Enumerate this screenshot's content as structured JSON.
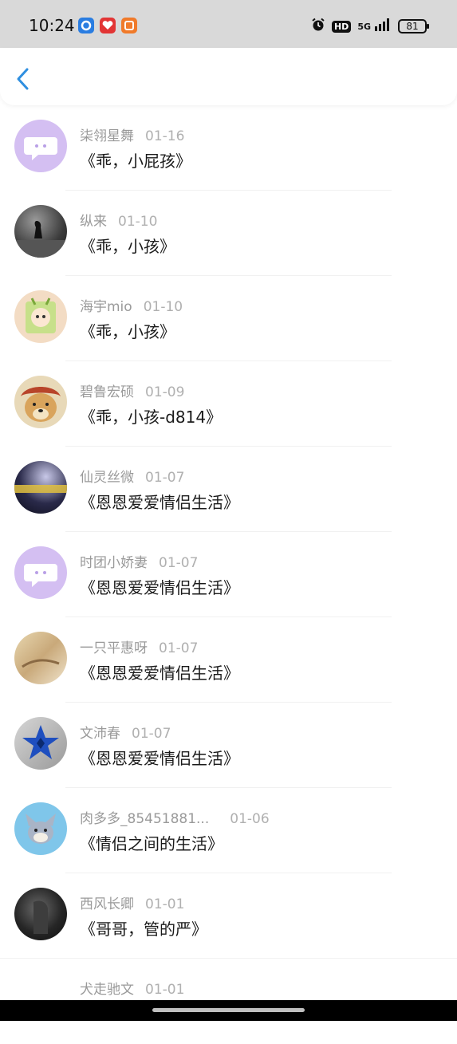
{
  "status": {
    "time": "10:24",
    "hd": "HD",
    "network": "5G",
    "battery": "81"
  },
  "items": [
    {
      "name": "柒翎星舞",
      "date": "01-16",
      "title": "《乖，小屁孩》",
      "avatar": "chat-bubble-avatar"
    },
    {
      "name": "纵来",
      "date": "01-10",
      "title": "《乖，小孩》",
      "avatar": "photo-avatar"
    },
    {
      "name": "海宇mio",
      "date": "01-10",
      "title": "《乖，小孩》",
      "avatar": "cartoon-avatar"
    },
    {
      "name": "碧鲁宏硕",
      "date": "01-09",
      "title": "《乖，小孩-d814》",
      "avatar": "dog-avatar"
    },
    {
      "name": "仙灵丝微",
      "date": "01-07",
      "title": "《恩恩爱爱情侣生活》",
      "avatar": "photo-avatar"
    },
    {
      "name": "时团小娇妻",
      "date": "01-07",
      "title": "《恩恩爱爱情侣生活》",
      "avatar": "chat-bubble-avatar"
    },
    {
      "name": "一只平惠呀",
      "date": "01-07",
      "title": "《恩恩爱爱情侣生活》",
      "avatar": "photo-avatar"
    },
    {
      "name": "文沛春",
      "date": "01-07",
      "title": "《恩恩爱爱情侣生活》",
      "avatar": "star-avatar"
    },
    {
      "name": "肉多多_85451881...",
      "date": "01-06",
      "title": "《情侣之间的生活》",
      "avatar": "cartoon-cat-avatar"
    },
    {
      "name": "西风长卿",
      "date": "01-01",
      "title": "《哥哥，管的严》",
      "avatar": "photo-avatar"
    },
    {
      "name": "犬走驰文",
      "date": "01-01",
      "title": "",
      "avatar": "photo-avatar"
    }
  ],
  "colors": {
    "accent": "#2f8fe0",
    "chat_avatar_bg": "#d4bff2"
  }
}
